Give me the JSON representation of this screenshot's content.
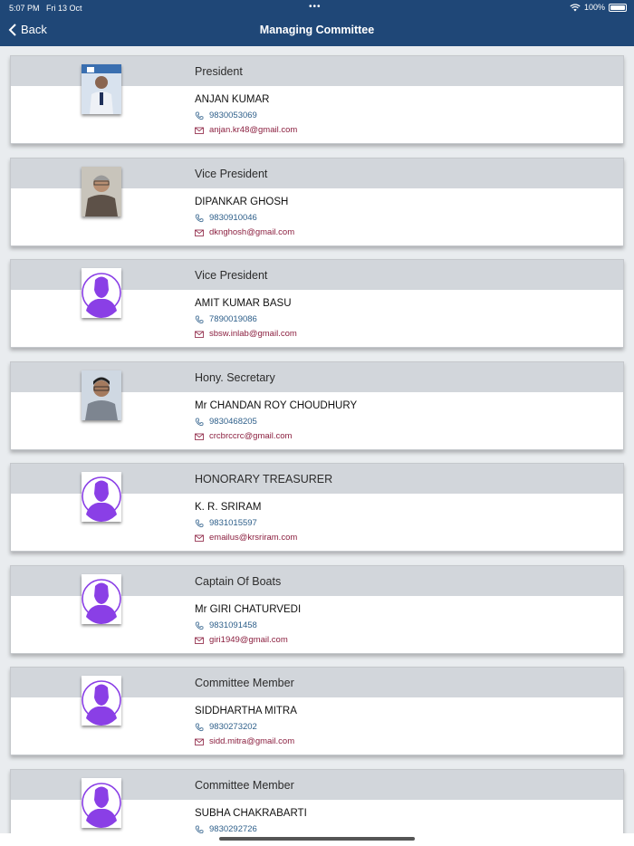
{
  "status_bar": {
    "time": "5:07 PM",
    "date": "Fri 13 Oct",
    "dots": "•••",
    "battery": "100%"
  },
  "nav": {
    "back_label": "Back",
    "title": "Managing Committee"
  },
  "colors": {
    "nav_bg": "#1f4777",
    "band_bg": "#d2d6db",
    "phone_text": "#2e5f8a",
    "email_text": "#8b1f3f",
    "placeholder_avatar": "#8a3fe6"
  },
  "members": [
    {
      "role": "President",
      "name": "ANJAN  KUMAR",
      "phone": "9830053069",
      "email": "anjan.kr48@gmail.com",
      "photo": "photo"
    },
    {
      "role": "Vice President",
      "name": "DIPANKAR GHOSH",
      "phone": " 9830910046",
      "email": "dknghosh@gmail.com",
      "photo": "photo"
    },
    {
      "role": "Vice President",
      "name": "AMIT KUMAR BASU",
      "phone": "7890019086",
      "email": "sbsw.inlab@gmail.com",
      "photo": "placeholder-avatar-icon"
    },
    {
      "role": "Hony. Secretary",
      "name": "Mr CHANDAN ROY CHOUDHURY",
      "phone": "9830468205",
      "email": "crcbrccrc@gmail.com",
      "photo": "photo"
    },
    {
      "role": "HONORARY TREASURER",
      "name": "K. R. SRIRAM",
      "phone": "9831015597",
      "email": "emailus@krsriram.com",
      "photo": "placeholder-avatar-icon"
    },
    {
      "role": "Captain  Of Boats",
      "name": "Mr GIRI CHATURVEDI",
      "phone": "9831091458",
      "email": "giri1949@gmail.com",
      "photo": "placeholder-avatar-icon"
    },
    {
      "role": "Committee Member",
      "name": "SIDDHARTHA MITRA",
      "phone": "9830273202",
      "email": "sidd.mitra@gmail.com",
      "photo": "placeholder-avatar-icon"
    },
    {
      "role": "Committee Member",
      "name": "SUBHA  CHAKRABARTI",
      "phone": "9830292726",
      "email": "",
      "photo": "placeholder-avatar-icon"
    }
  ]
}
